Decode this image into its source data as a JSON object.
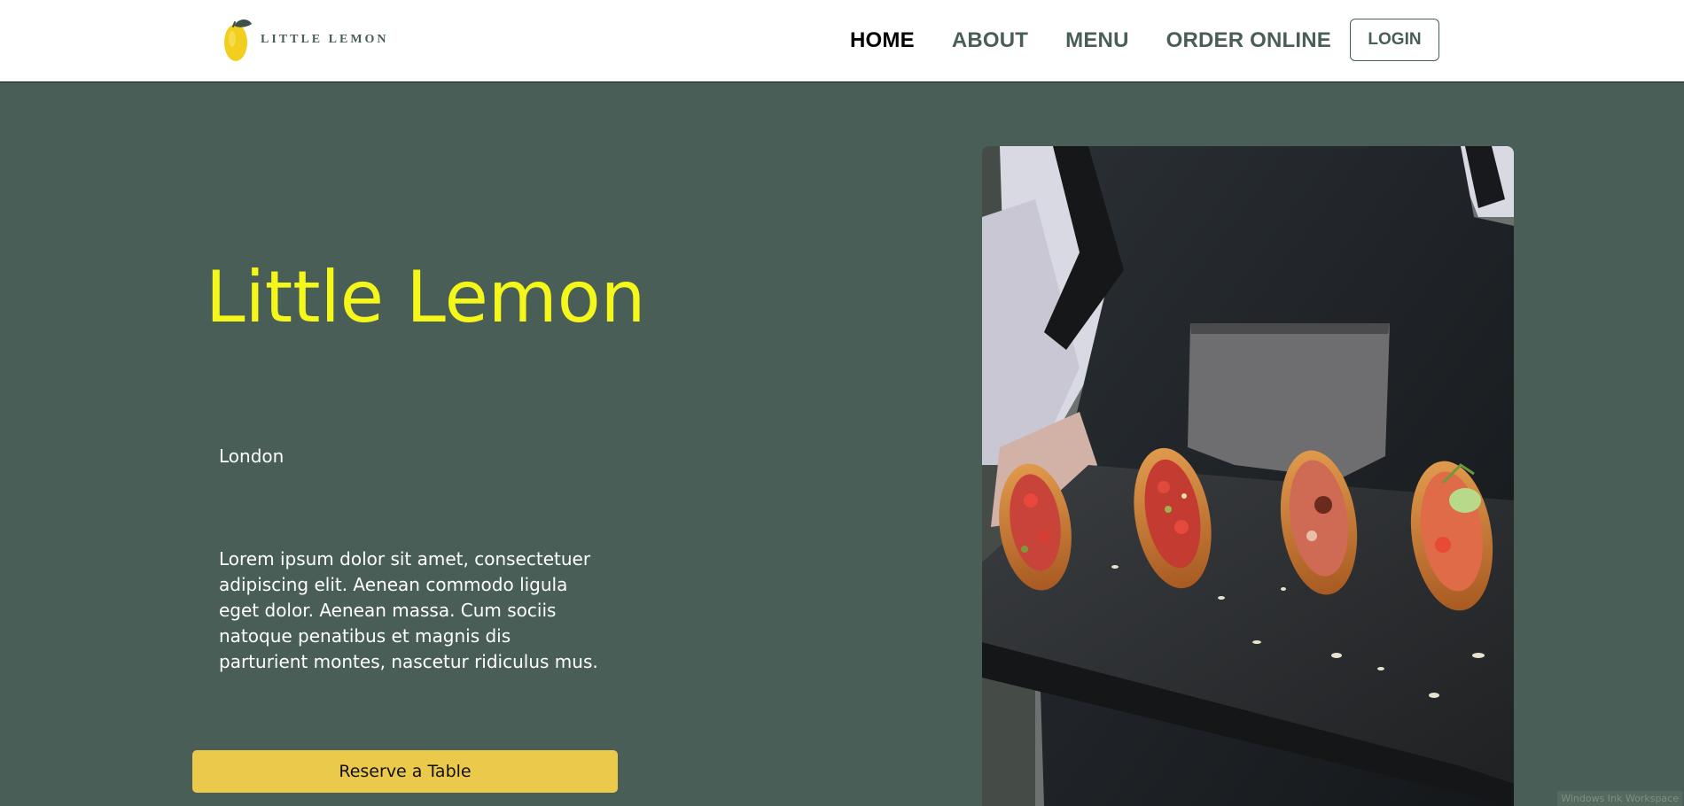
{
  "header": {
    "logo": {
      "text": "LITTLE LEMON"
    },
    "nav": [
      {
        "label": "HOME",
        "active": true
      },
      {
        "label": "ABOUT",
        "active": false
      },
      {
        "label": "MENU",
        "active": false
      },
      {
        "label": "ORDER ONLINE",
        "active": false
      }
    ],
    "login_label": "LOGIN"
  },
  "hero": {
    "title": "Little Lemon",
    "city": "London",
    "description": "Lorem ipsum dolor sit amet, consectetuer adipiscing elit. Aenean commodo ligula eget dolor. Aenean massa. Cum sociis natoque penatibus et magnis dis parturient montes, nascetur ridiculus mus.",
    "reserve_label": "Reserve a Table",
    "image_icon": "food-platter-photo"
  },
  "taskbar": {
    "ink_workspace_label": "Windows Ink Workspace"
  },
  "colors": {
    "primary_green": "#495e57",
    "primary_yellow": "#f4ce14",
    "title_yellow": "#f4f719",
    "button_yellow": "#eac94b",
    "header_bg": "#ffffff"
  }
}
